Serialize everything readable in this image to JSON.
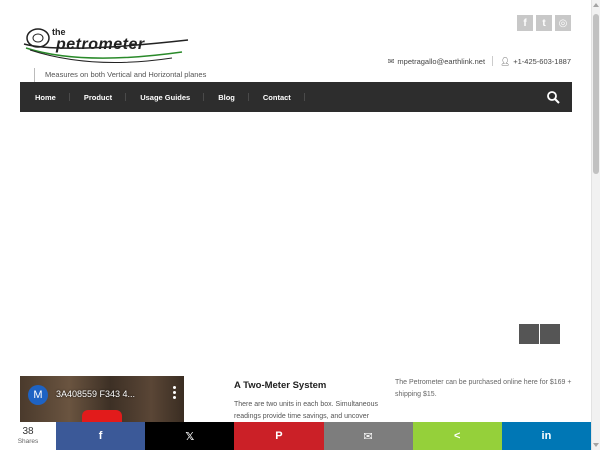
{
  "header": {
    "logo_text": "the Petrometer",
    "tagline": "Measures on both Vertical and Horizontal planes",
    "social": [
      {
        "name": "facebook",
        "glyph": "f"
      },
      {
        "name": "twitter",
        "glyph": "t"
      },
      {
        "name": "dribbble",
        "glyph": "◎"
      }
    ],
    "email": "mpetragallo@earthlink.net",
    "phone": "+1-425-603-1887"
  },
  "nav": {
    "items": [
      "Home",
      "Product",
      "Usage Guides",
      "Blog",
      "Contact"
    ]
  },
  "video": {
    "avatar_letter": "M",
    "title": "3A408559 F343 4..."
  },
  "article": {
    "title": "A Two-Meter System",
    "body": "There are two units in each box. Simultaneous readings provide time savings, and uncover"
  },
  "purchase": {
    "text": "The Petrometer can be purchased online here for $169 + shipping $15."
  },
  "share": {
    "count": "38",
    "count_label": "Shares",
    "buttons": [
      {
        "name": "facebook",
        "glyph": "f"
      },
      {
        "name": "x",
        "glyph": "𝕏"
      },
      {
        "name": "pinterest",
        "glyph": "P"
      },
      {
        "name": "email",
        "glyph": "✉"
      },
      {
        "name": "share",
        "glyph": "<"
      },
      {
        "name": "linkedin",
        "glyph": "in"
      }
    ]
  },
  "colors": {
    "nav_bg": "#2d2d2d",
    "facebook": "#3b5998",
    "x": "#000000",
    "pinterest": "#cb2027",
    "email": "#7d7d7d",
    "share": "#95d03a",
    "linkedin": "#0077b5"
  }
}
